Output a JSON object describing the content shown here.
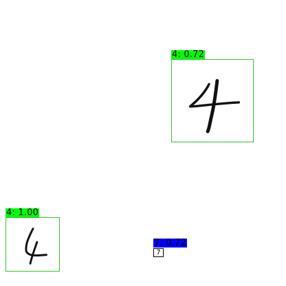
{
  "detections": [
    {
      "label": "4: 0.72",
      "color": "#00ff00",
      "digit_style": "upright-four"
    },
    {
      "label": "4: 1.00",
      "color": "#00ff00",
      "digit_style": "curvy-four"
    },
    {
      "label": "7: 0.72",
      "color": "#0000ff",
      "box_text": "7"
    }
  ]
}
